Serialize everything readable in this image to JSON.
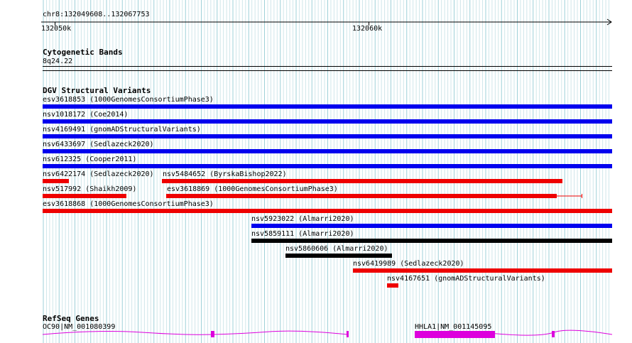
{
  "region": "chr8:132049608..132067753",
  "ruler": {
    "ticks": [
      {
        "label": "132050k",
        "pos": 132050000
      },
      {
        "label": "132060k",
        "pos": 132060000
      }
    ]
  },
  "view": {
    "start": 132049608,
    "end": 132067753
  },
  "tracks": {
    "cytobands": {
      "title": "Cytogenetic Bands",
      "band": "8q24.22"
    },
    "dgv": {
      "title": "DGV Structural Variants",
      "items": [
        {
          "label": "esv3618853 (1000GenomesConsortiumPhase3)",
          "color": "#0000ee",
          "start": 132049608,
          "end": 132067753
        },
        {
          "label": "nsv1018172 (Coe2014)",
          "color": "#0000ee",
          "start": 132049608,
          "end": 132067753
        },
        {
          "label": "nsv4169491 (gnomADStructuralVariants)",
          "color": "#0000ee",
          "start": 132049608,
          "end": 132067753
        },
        {
          "label": "nsv6433697 (Sedlazeck2020)",
          "color": "#0000ee",
          "start": 132049608,
          "end": 132067753
        },
        {
          "label": "nsv612325 (Cooper2011)",
          "color": "#0000ee",
          "start": 132049608,
          "end": 132067753
        },
        {
          "label": "nsv6422174 (Sedlazeck2020)",
          "color": "#ee0000",
          "start": 132049608,
          "end": 132050450
        },
        {
          "label": "nsv5484652 (ByrskaBishop2022)",
          "color": "#ee0000",
          "start": 132053410,
          "end": 132066160
        },
        {
          "label": "nsv517992 (Shaikh2009)",
          "color": "#ee0000",
          "start": 132049608,
          "end": 132052280
        },
        {
          "label": "esv3618869 (1000GenomesConsortiumPhase3)",
          "color": "#ee0000",
          "start": 132053550,
          "end": 132066000
        },
        {
          "label": "esv3618868 (1000GenomesConsortiumPhase3)",
          "color": "#ee0000",
          "start": 132049608,
          "end": 132067753
        },
        {
          "label": "nsv5923022 (Almarri2020)",
          "color": "#0000ee",
          "start": 132056250,
          "end": 132067753
        },
        {
          "label": "nsv5859111 (Almarri2020)",
          "color": "#000000",
          "start": 132056250,
          "end": 132067753
        },
        {
          "label": "nsv5860606 (Almarri2020)",
          "color": "#000000",
          "start": 132057340,
          "end": 132060730
        },
        {
          "label": "nsv6419989 (Sedlazeck2020)",
          "color": "#ee0000",
          "start": 132059500,
          "end": 132067753
        },
        {
          "label": "nsv4167651 (gnomADStructuralVariants)",
          "color": "#ee0000",
          "start": 132060570,
          "end": 132060930
        }
      ]
    },
    "refseq": {
      "title": "RefSeq Genes",
      "genes": [
        {
          "label": "OC90|NM_001080399",
          "color": "#dd00dd"
        },
        {
          "label": "HHLA1|NM_001145095",
          "color": "#dd00dd"
        }
      ]
    }
  }
}
